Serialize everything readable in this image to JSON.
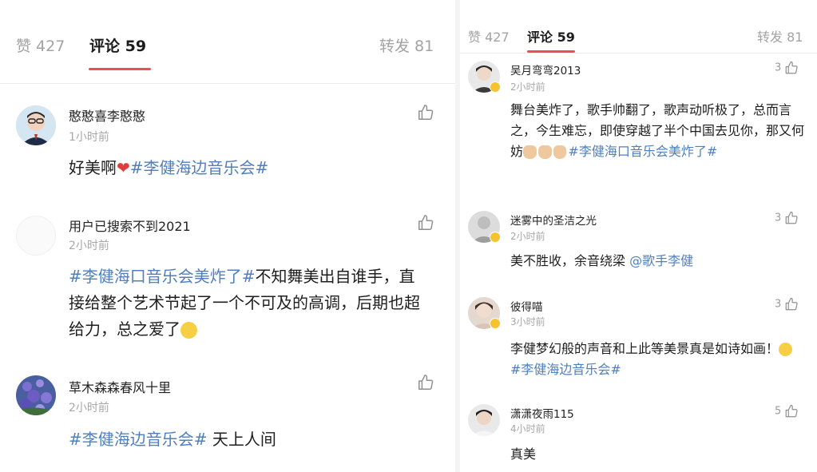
{
  "left": {
    "tabs": {
      "likes": "赞 427",
      "comments": "评论 59",
      "reposts": "转发 81"
    },
    "comments": [
      {
        "username": "憨憨喜李憨憨",
        "time": "1小时前",
        "parts": [
          {
            "t": "好美啊"
          },
          {
            "t": "❤",
            "k": "heart"
          },
          {
            "t": "#李健海边音乐会#",
            "k": "tag"
          }
        ]
      },
      {
        "username": "用户已搜索不到2021",
        "time": "2小时前",
        "parts": [
          {
            "t": "#李健海口音乐会美炸了#",
            "k": "tag"
          },
          {
            "t": "不知舞美出自谁手，直接给整个艺术节起了一个不可及的高调，后期也超给力，总之爱了"
          },
          {
            "t": "",
            "k": "face"
          }
        ]
      },
      {
        "username": "草木森森春风十里",
        "time": "2小时前",
        "parts": [
          {
            "t": "#李健海边音乐会#",
            "k": "tag"
          },
          {
            "t": "  天上人间"
          }
        ]
      }
    ]
  },
  "right": {
    "tabs": {
      "likes": "赞 427",
      "comments": "评论 59",
      "reposts": "转发 81"
    },
    "comments": [
      {
        "username": "吴月弯弯2013",
        "time": "2小时前",
        "likes": "3",
        "parts": [
          {
            "t": "舞台美炸了，歌手帅翻了，歌声动听极了，总而言之，今生难忘，即使穿越了半个中国去见你，那又何妨"
          },
          {
            "t": "",
            "k": "thumb"
          },
          {
            "t": "",
            "k": "thumb"
          },
          {
            "t": "",
            "k": "thumb"
          },
          {
            "t": "#李健海口音乐会美炸了#",
            "k": "tag"
          }
        ]
      },
      {
        "username": "迷雾中的圣洁之光",
        "time": "2小时前",
        "likes": "3",
        "parts": [
          {
            "t": "美不胜收，余音绕梁 "
          },
          {
            "t": "@歌手李健",
            "k": "mention"
          }
        ]
      },
      {
        "username": "彼得喵",
        "time": "3小时前",
        "likes": "3",
        "parts": [
          {
            "t": "李健梦幻般的声音和上此等美景真是如诗如画！"
          },
          {
            "t": "",
            "k": "smile"
          },
          {
            "t": "#李健海边音乐会#",
            "k": "tag"
          }
        ]
      },
      {
        "username": "潇潇夜雨115",
        "time": "4小时前",
        "likes": "5",
        "parts": [
          {
            "t": "真美"
          }
        ]
      }
    ]
  },
  "colors": {
    "accent": "#ef4d55",
    "link": "#4f7fbf",
    "muted": "#a8a8a8",
    "verified": "#f5c32e"
  },
  "icons": {
    "like": "thumbs-up-outline-icon",
    "verified": "verified-badge-icon"
  }
}
